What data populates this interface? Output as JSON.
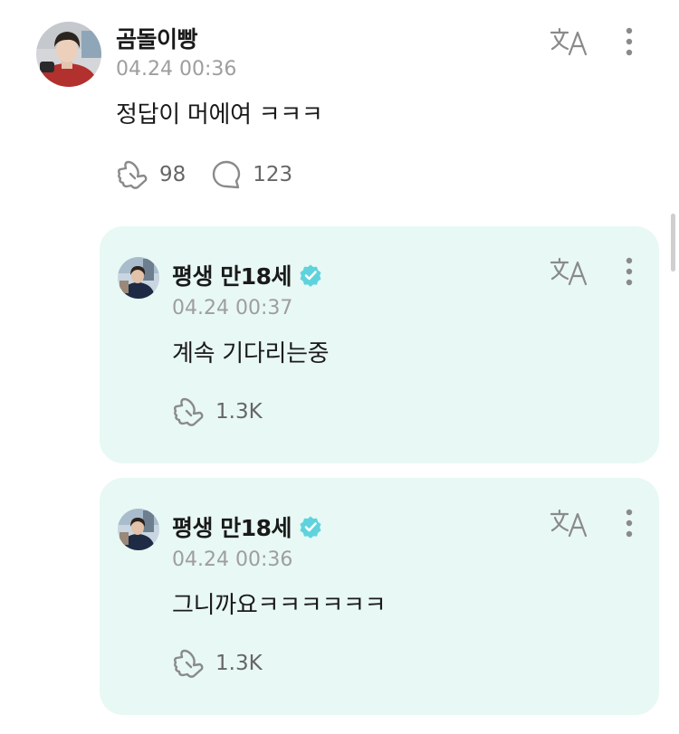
{
  "post": {
    "author": "곰돌이빵",
    "time": "04.24 00:36",
    "text": "정답이 머에여 ㅋㅋㅋ",
    "like_count": "98",
    "comment_count": "123"
  },
  "replies": [
    {
      "author": "평생 만18세",
      "time": "04.24 00:37",
      "text": "계속 기다리는중",
      "like_count": "1.3K"
    },
    {
      "author": "평생 만18세",
      "time": "04.24 00:36",
      "text": "그니까요ㅋㅋㅋㅋㅋㅋ",
      "like_count": "1.3K"
    }
  ],
  "icons": {
    "translate": "translate-icon",
    "more": "more-vertical-icon",
    "like": "like-icon",
    "comment": "comment-icon",
    "verified": "verified-badge-icon"
  },
  "colors": {
    "reply_background": "#e8f8f4",
    "verified": "#5fd3dd",
    "timestamp": "#9e9e9e",
    "icon": "#8a8a8a"
  }
}
